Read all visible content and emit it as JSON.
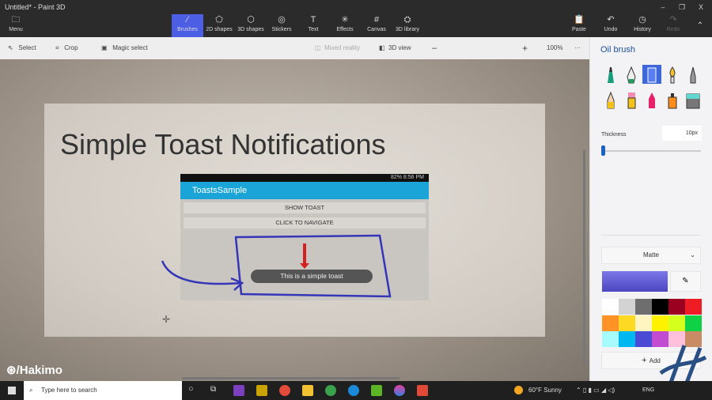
{
  "window": {
    "title": "Untitled* - Paint 3D",
    "minimize": "–",
    "restore": "❐",
    "close": "X"
  },
  "ribbon": {
    "menu": "Menu",
    "tabs": [
      "Brushes",
      "2D shapes",
      "3D shapes",
      "Stickers",
      "Text",
      "Effects",
      "Canvas",
      "3D library"
    ],
    "active_tab": "Brushes",
    "right": [
      "Paste",
      "Undo",
      "History",
      "Redo"
    ]
  },
  "toolbar": {
    "select": "Select",
    "crop": "Crop",
    "magic_select": "Magic select",
    "mixed_reality": "Mixed reality",
    "view3d": "3D view",
    "zoom_minus": "–",
    "zoom_plus": "+",
    "zoom": "100%",
    "more": "···",
    "zoom_level_percent": 100
  },
  "canvas": {
    "title": "Simple Toast Notifications",
    "phone": {
      "status_time": "82%  8:56 PM",
      "app_title": "ToastsSample",
      "button1": "SHOW TOAST",
      "button2": "CLICK TO NAVIGATE",
      "toast": "This is a simple toast"
    }
  },
  "panel": {
    "title": "Oil brush",
    "thickness_label": "Thickness",
    "thickness_value": "10px",
    "thickness_fraction": 0.0,
    "finish": "Matte",
    "current_color": "#5b54cf",
    "add": "Add",
    "palette": [
      "#ffffff",
      "#d3d3d3",
      "#6e6e6e",
      "#000000",
      "#9b0020",
      "#ee1c24",
      "#ff9326",
      "#fdd924",
      "#fff5c0",
      "#fff200",
      "#d5ff1c",
      "#0ed145",
      "#a6fcfc",
      "#00b7ef",
      "#4a4ad4",
      "#c14bd1",
      "#ffc0dc",
      "#c88b64"
    ],
    "tools": [
      "marker",
      "calligraphy-pen",
      "oil-brush",
      "watercolor",
      "pencil",
      "graphite-pencil",
      "eraser",
      "crayon",
      "spray-can",
      "fill-bucket"
    ],
    "active_tool": "oil-brush"
  },
  "watermark": "/Hakimo",
  "taskbar": {
    "search_placeholder": "Type here to search",
    "weather": "60°F  Sunny",
    "lang": "ENG"
  }
}
